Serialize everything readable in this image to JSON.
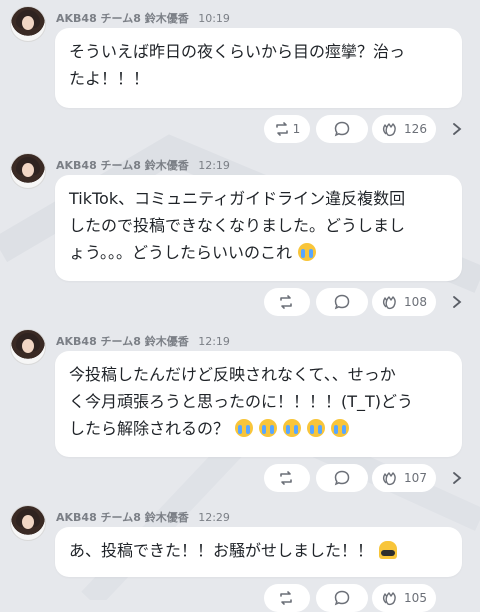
{
  "posts": [
    {
      "author": "AKB48 チーム8 鈴木優香",
      "time": "10:19",
      "lines": [
        "そういえば昨日の夜くらいから目の痙攣？治っ",
        "たよ！！！"
      ],
      "emoji": [],
      "repost_count": "1",
      "like_count": "126"
    },
    {
      "author": "AKB48 チーム8 鈴木優香",
      "time": "12:19",
      "lines": [
        "TikTok、コミュニティガイドライン違反複数回",
        "したので投稿できなくなりました。どうしまし",
        "ょう。。。どうしたらいいのこれ"
      ],
      "emoji": [
        "loudly-crying-face"
      ],
      "repost_count": "",
      "like_count": "108"
    },
    {
      "author": "AKB48 チーム8 鈴木優香",
      "time": "12:19",
      "lines": [
        "今投稿したんだけど反映されなくて、、せっか",
        "く今月頑張ろうと思ったのに！！！！(T_T)どう",
        "したら解除されるの？"
      ],
      "emoji": [
        "loudly-crying-face",
        "loudly-crying-face",
        "loudly-crying-face",
        "loudly-crying-face",
        "loudly-crying-face"
      ],
      "repost_count": "",
      "like_count": "107"
    },
    {
      "author": "AKB48 チーム8 鈴木優香",
      "time": "12:29",
      "lines": [
        "あ、投稿できた！！お騒がせしました！！"
      ],
      "emoji": [
        "bowing-person"
      ],
      "repost_count": "",
      "like_count": "105"
    }
  ],
  "colors": {
    "background": "#e6e8ec",
    "bubble": "#ffffff",
    "meta_text": "#7b7f86",
    "action_icon": "#6c7078"
  }
}
